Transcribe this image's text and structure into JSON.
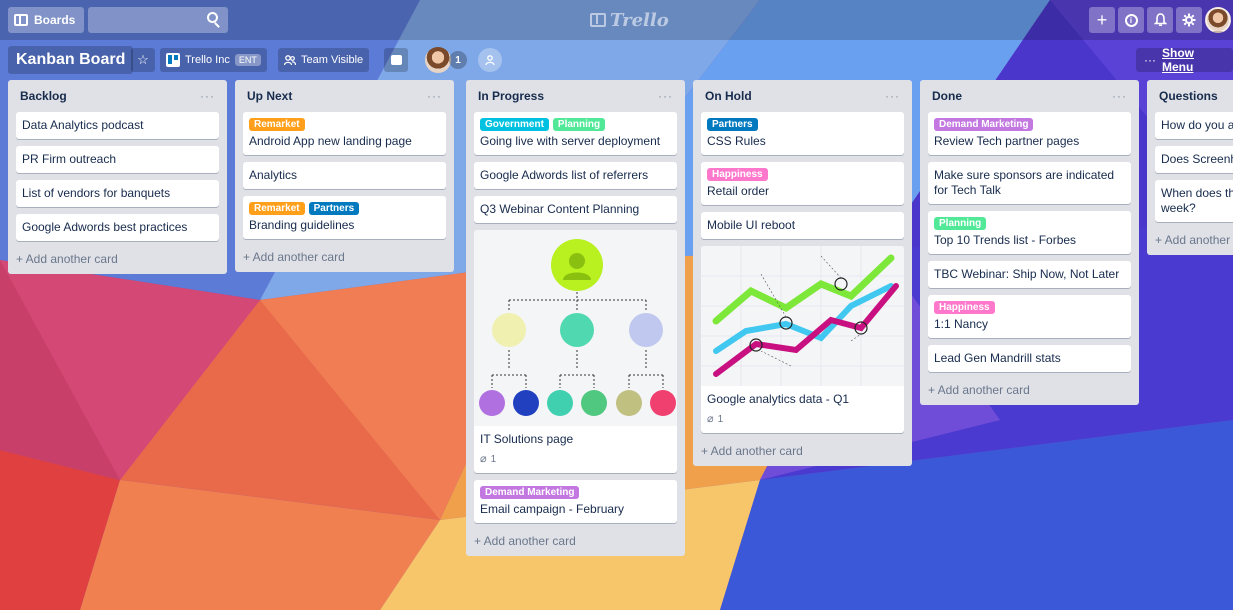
{
  "colors": {
    "green": "#61bd4f",
    "orange": "#ff9f1a",
    "blue": "#0079bf",
    "sky": "#00c2e0",
    "pink": "#ff78cb",
    "purple": "#c377e0",
    "lime": "#51e898"
  },
  "topbar": {
    "boards_label": "Boards",
    "logo_text": "Trello",
    "icons": [
      "board-icon",
      "search-icon",
      "plus-icon",
      "info-icon",
      "bell-icon",
      "gear-icon",
      "avatar"
    ]
  },
  "board": {
    "title": "Kanban Board",
    "team_name": "Trello Inc",
    "team_badge": "ENT",
    "visibility": "Team Visible",
    "member_count": "1",
    "show_menu_label": "Show Menu",
    "show_menu_prefix": "···"
  },
  "lists": [
    {
      "title": "Backlog",
      "cards": [
        {
          "text": "Data Analytics podcast"
        },
        {
          "text": "PR Firm outreach"
        },
        {
          "text": "List of vendors for banquets"
        },
        {
          "text": "Google Adwords best practices"
        }
      ],
      "add_label": "+ Add another card"
    },
    {
      "title": "Up Next",
      "cards": [
        {
          "labels": [
            {
              "text": "Remarket",
              "color": "#ff9f1a"
            }
          ],
          "text": "Android App new landing page"
        },
        {
          "text": "Analytics"
        },
        {
          "labels": [
            {
              "text": "Remarket",
              "color": "#ff9f1a"
            },
            {
              "text": "Partners",
              "color": "#0079bf"
            }
          ],
          "text": "Branding guidelines"
        }
      ],
      "add_label": "+ Add another card"
    },
    {
      "title": "In Progress",
      "cards": [
        {
          "labels": [
            {
              "text": "Government",
              "color": "#00c2e0"
            },
            {
              "text": "Planning",
              "color": "#51e898"
            }
          ],
          "text": "Going live with server deployment"
        },
        {
          "text": "Google Adwords list of referrers"
        },
        {
          "text": "Q3 Webinar Content Planning"
        },
        {
          "cover": "org-chart",
          "text": "IT Solutions page",
          "attachments": "1"
        },
        {
          "labels": [
            {
              "text": "Demand Marketing",
              "color": "#c377e0"
            }
          ],
          "text": "Email campaign - February"
        }
      ],
      "add_label": "+ Add another card"
    },
    {
      "title": "On Hold",
      "cards": [
        {
          "labels": [
            {
              "text": "Partners",
              "color": "#0079bf"
            }
          ],
          "text": "CSS Rules"
        },
        {
          "labels": [
            {
              "text": "Happiness",
              "color": "#ff78cb"
            }
          ],
          "text": "Retail order"
        },
        {
          "text": "Mobile UI reboot"
        },
        {
          "cover": "line-chart",
          "text": "Google analytics data - Q1",
          "attachments": "1"
        }
      ],
      "add_label": "+ Add another card"
    },
    {
      "title": "Done",
      "cards": [
        {
          "labels": [
            {
              "text": "Demand Marketing",
              "color": "#c377e0"
            }
          ],
          "text": "Review Tech partner pages"
        },
        {
          "text": "Make sure sponsors are indicated for Tech Talk"
        },
        {
          "labels": [
            {
              "text": "Planning",
              "color": "#51e898"
            }
          ],
          "text": "Top 10 Trends list - Forbes"
        },
        {
          "text": "TBC Webinar: Ship Now, Not Later"
        },
        {
          "labels": [
            {
              "text": "Happiness",
              "color": "#ff78cb"
            }
          ],
          "text": "1:1 Nancy"
        },
        {
          "text": "Lead Gen Mandrill stats"
        }
      ],
      "add_label": "+ Add another card"
    },
    {
      "title": "Questions",
      "cards": [
        {
          "text": "How do you add Illustrator?"
        },
        {
          "text": "Does Screenhero"
        },
        {
          "text": "When does the increase - before week?"
        }
      ],
      "add_label": "+ Add another card"
    }
  ]
}
